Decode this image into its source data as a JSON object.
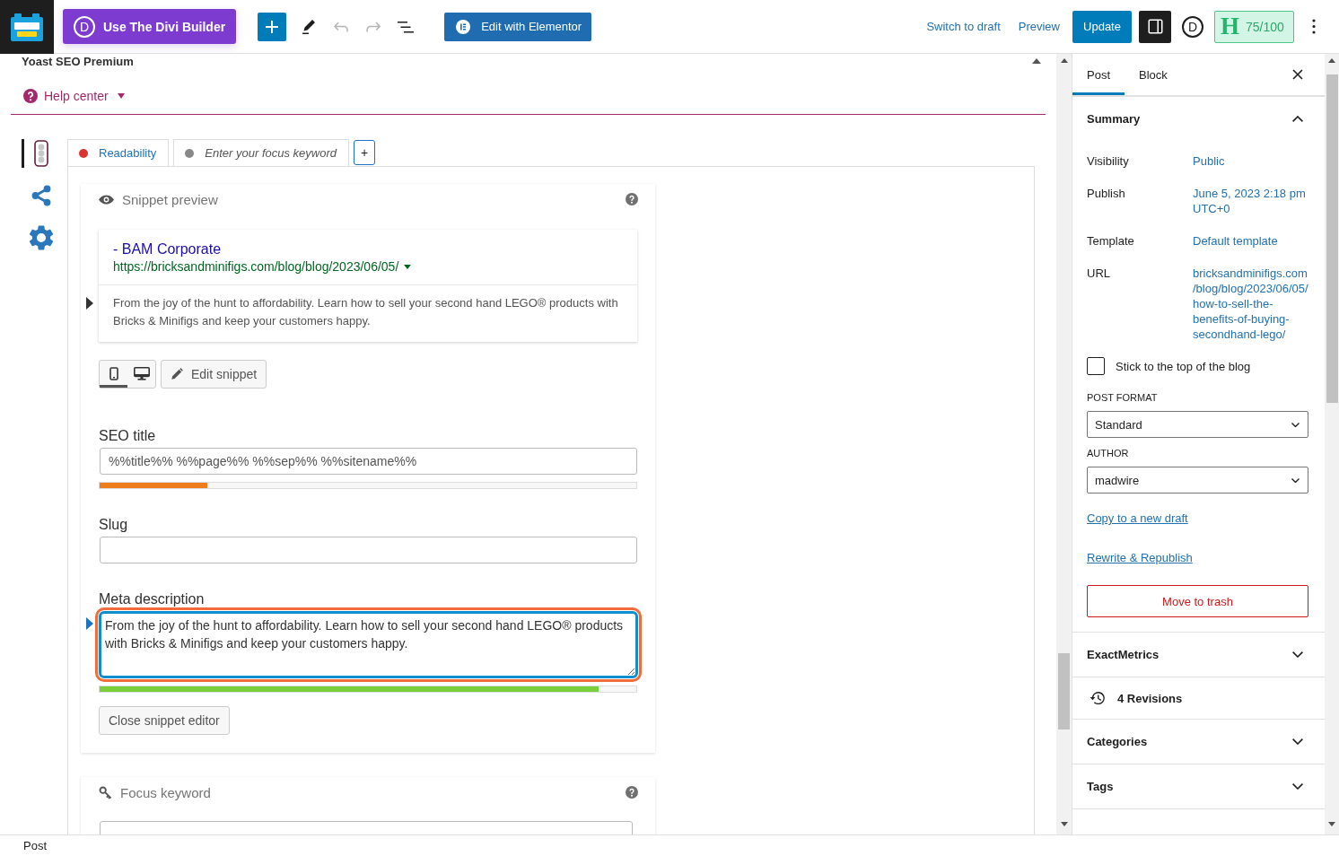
{
  "top_bar": {
    "divi_button": {
      "icon": "D",
      "label": "Use The Divi Builder"
    },
    "tools": [
      {
        "kind": "add",
        "disabled": false
      },
      {
        "kind": "edit",
        "disabled": false
      },
      {
        "kind": "undo",
        "disabled": true
      },
      {
        "kind": "redo",
        "disabled": true
      },
      {
        "kind": "list",
        "disabled": false
      }
    ],
    "elementor_button": "Edit with Elementor",
    "switch_to_draft": "Switch to draft",
    "preview": "Preview",
    "update": "Update",
    "sidebar_toggle": {
      "pressed": true
    },
    "divi_icon": "D",
    "seo_score": {
      "icon": "H",
      "score": "75/100"
    }
  },
  "yoast": {
    "title": "Yoast SEO Premium",
    "expanded": true,
    "help_center": "Help center",
    "nav": [
      {
        "kind": "analysis",
        "selected": true
      },
      {
        "kind": "social",
        "selected": false
      },
      {
        "kind": "settings",
        "selected": false
      }
    ],
    "tabs": [
      {
        "kind": "readability",
        "label": "Readability",
        "color": "#dc3232",
        "selected": true
      },
      {
        "kind": "keyword",
        "label": "Enter your focus keyword",
        "color": "#888888",
        "selected": false
      }
    ],
    "add_keyword": "+",
    "snippet_preview": {
      "heading": "Snippet preview",
      "title": "- BAM Corporate",
      "url": "https://bricksandminifigs.com/blog/blog/2023/06/05/",
      "description": "From the joy of the hunt to affordability. Learn how to sell your second hand LEGO® products with Bricks & Minifigs and keep your customers happy.",
      "description_marked": true,
      "modes": [
        {
          "kind": "mobile",
          "selected": true
        },
        {
          "kind": "desktop",
          "selected": false
        }
      ],
      "edit_button": "Edit snippet"
    },
    "snippet_editor": {
      "fields": [
        {
          "kind": "input",
          "label": "SEO title",
          "value": "%%title%% %%page%% %%sep%% %%sitename%%",
          "focused": false,
          "highlighted": false,
          "level": 0.2,
          "color": "#ee7c1b"
        },
        {
          "kind": "input",
          "label": "Slug",
          "focused": false,
          "highlighted": false
        },
        {
          "kind": "textarea",
          "label": "Meta description",
          "value": "From the joy of the hunt to affordability. Learn how to sell your second hand LEGO® products with Bricks & Minifigs and keep your customers happy.",
          "focused": true,
          "highlighted": true,
          "level": 0.93,
          "color": "#7ad03a"
        }
      ],
      "close_button": "Close snippet editor"
    },
    "focus_keyword": {
      "heading": "Focus keyword"
    }
  },
  "sidebar": {
    "tabs": [
      {
        "label": "Post",
        "selected": true
      },
      {
        "label": "Block",
        "selected": false
      }
    ],
    "summary": {
      "title": "Summary",
      "expanded": true,
      "rows": [
        {
          "label": "Visibility",
          "value": "Public"
        },
        {
          "label": "Publish",
          "value": "June 5, 2023 2:18 pm UTC+0"
        },
        {
          "label": "Template",
          "value": "Default template"
        },
        {
          "label": "URL",
          "value": "bricksandminifigs.com/blog/blog/2023/06/05/how-to-sell-the-benefits-of-buying-secondhand-lego/"
        }
      ]
    },
    "sticky": {
      "label": "Stick to the top of the blog",
      "checked": false
    },
    "post_format": {
      "label": "POST FORMAT",
      "value": "Standard"
    },
    "author": {
      "label": "AUTHOR",
      "value": "madwire"
    },
    "links": [
      "Copy to a new draft",
      "Rewrite & Republish"
    ],
    "trash_button": "Move to trash",
    "panels": [
      {
        "kind": "panel",
        "title": "ExactMetrics",
        "expanded": false
      },
      {
        "kind": "revisions",
        "title": "4 Revisions"
      },
      {
        "kind": "panel",
        "title": "Categories",
        "expanded": false
      },
      {
        "kind": "panel",
        "title": "Tags",
        "expanded": false
      }
    ]
  },
  "status_bar": {
    "breadcrumb": "Post"
  }
}
